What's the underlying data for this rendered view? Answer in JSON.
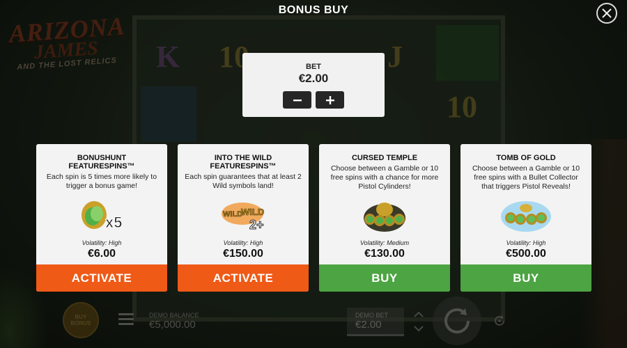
{
  "header": {
    "title": "BONUS BUY"
  },
  "logo": {
    "line1": "ARIZONA",
    "line2": "JAMES",
    "line3": "AND THE LOST RELICS"
  },
  "bet": {
    "label": "BET",
    "value": "€2.00"
  },
  "cards": [
    {
      "title": "BONUSHUNT\nFEATURESPINS™",
      "desc": "Each spin is 5 times more likely to trigger a bonus game!",
      "volatility": "Volatility: High",
      "price": "€6.00",
      "action": "ACTIVATE",
      "icon": "bonushunt-x5-icon",
      "action_color": "#ef5a17"
    },
    {
      "title": "INTO THE WILD\nFEATURESPINS™",
      "desc": "Each spin guarantees that at least 2 Wild symbols land!",
      "volatility": "Volatility: High",
      "price": "€150.00",
      "action": "ACTIVATE",
      "icon": "wild-2plus-icon",
      "action_color": "#ef5a17"
    },
    {
      "title": "CURSED TEMPLE",
      "desc": "Choose between a Gamble or 10 free spins with a chance for more Pistol Cylinders!",
      "volatility": "Volatility: Medium",
      "price": "€130.00",
      "action": "BUY",
      "icon": "cursed-temple-icon",
      "action_color": "#4ca442"
    },
    {
      "title": "TOMB OF GOLD",
      "desc": "Choose between a Gamble or 10 free spins with a Bullet Collector that triggers Pistol Reveals!",
      "volatility": "Volatility: High",
      "price": "€500.00",
      "action": "BUY",
      "icon": "tomb-of-gold-icon",
      "action_color": "#4ca442"
    }
  ],
  "bottom": {
    "buy_bonus": "BUY BONUS",
    "demo_balance_label": "DEMO BALANCE",
    "demo_balance_value": "€5,000.00",
    "demo_bet_label": "DEMO BET",
    "demo_bet_value": "€2.00"
  },
  "card_icon_labels": {
    "x5": "x5",
    "wild": "WILD",
    "two_plus": "2+"
  }
}
